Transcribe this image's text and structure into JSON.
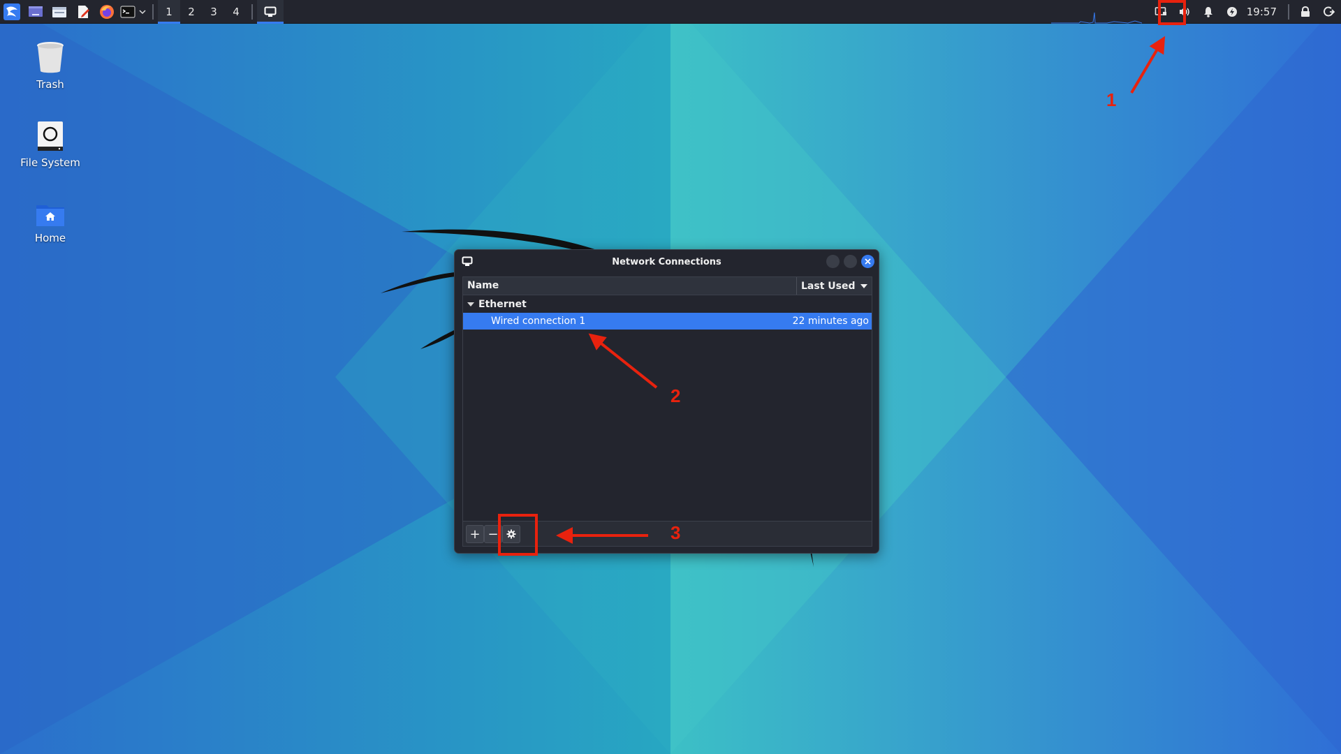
{
  "panel": {
    "workspaces": [
      "1",
      "2",
      "3",
      "4"
    ],
    "active_workspace": "1",
    "clock": "19:57",
    "launchers": [
      "kali-menu-icon",
      "desktop-icon",
      "file-manager-icon",
      "text-editor-icon",
      "firefox-icon",
      "terminal-icon"
    ]
  },
  "desktop": {
    "icons": [
      {
        "label": "Trash"
      },
      {
        "label": "File System"
      },
      {
        "label": "Home"
      }
    ]
  },
  "window": {
    "title": "Network Connections",
    "columns": {
      "name": "Name",
      "last_used": "Last Used"
    },
    "group": "Ethernet",
    "connection": {
      "name": "Wired connection 1",
      "last_used": "22 minutes ago"
    },
    "toolbar": {
      "add": "+",
      "remove": "−"
    }
  },
  "annotations": [
    "1",
    "2",
    "3"
  ],
  "colors": {
    "accent": "#367bf0",
    "annotation": "#e8220e",
    "panel": "#23252e"
  }
}
